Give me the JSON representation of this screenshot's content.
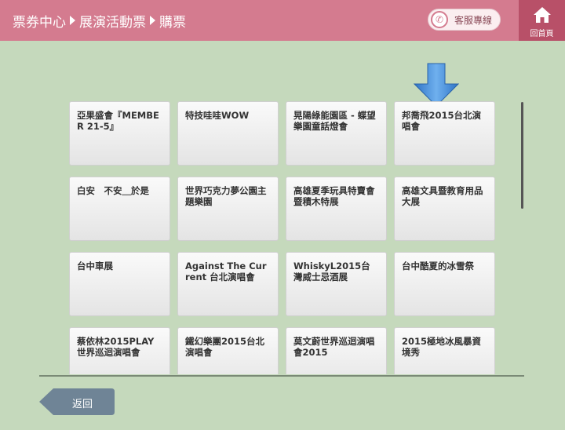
{
  "header": {
    "breadcrumb": [
      "票券中心",
      "展演活動票",
      "購票"
    ],
    "service_label": "客服專線",
    "home_label": "回首頁"
  },
  "colors": {
    "header": "#d47b8f",
    "home": "#b85068",
    "background": "#c5d9bc",
    "arrow": "#4a90d9"
  },
  "tiles": [
    "亞果盛會『MEMBER 21-5』",
    "特技哇哇WOW",
    "晃陽綠能園區 - 蝶望樂園童話燈會",
    "邦喬飛2015台北演唱會",
    "白安　不安＿於是",
    "世界巧克力夢公園主題樂園",
    "高雄夏季玩具特賣會暨積木特展",
    "高雄文具暨教育用品大展",
    "台中車展",
    "Against The Current 台北演唱會",
    "WhiskyL2015台灣威士忌酒展",
    "台中酷夏的冰雪祭",
    "蔡依林2015PLAY世界巡迴演唱會",
    "鐵幻樂團2015台北演唱會",
    "莫文蔚世界巡迴演唱會2015",
    "2015極地冰風暴資境秀"
  ],
  "footer": {
    "back_label": "返回"
  }
}
